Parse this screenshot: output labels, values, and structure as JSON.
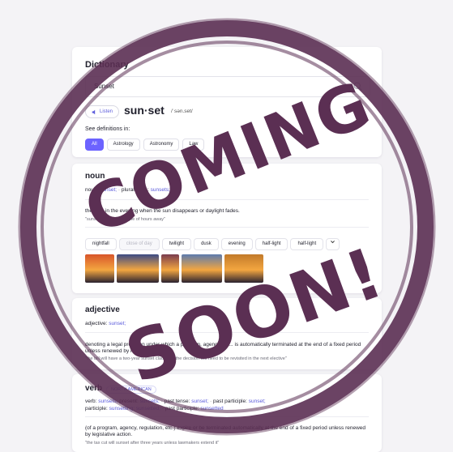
{
  "dictionary": {
    "title": "Dictionary",
    "search_value": "Sunset",
    "listen_label": "Listen",
    "word": "sun·set",
    "pronunciation": "/ˈsən.set/",
    "see_definitions_label": "See definitions in:",
    "chips": [
      "All",
      "Astrology",
      "Astronomy",
      "Law"
    ]
  },
  "noun": {
    "pos": "noun",
    "forms_label": "noun:",
    "forms_value": "sunset;",
    "plural_label": "plural noun:",
    "plural_value": "sunsets;",
    "definition": "the time in the evening when the sun disappears or daylight fades.",
    "example": "\"sunset was still a couple of hours away\"",
    "synonyms": [
      "nightfall",
      "close of day",
      "twilight",
      "dusk",
      "evening",
      "half-light",
      "half-light"
    ],
    "photo_colors": [
      "#d8552a",
      "#3c4b84",
      "#7a3c4e",
      "#5c7bae",
      "#c27a2a"
    ]
  },
  "adjective": {
    "pos": "adjective",
    "forms_label": "adjective:",
    "forms_value": "sunset;",
    "definition": "denoting a legal provision under which a program, agency, or ... is automatically terminated at the end of a fixed period unless renewed by legislative action.",
    "example": "\"the bill will have a two-year sunset clause so the decision will need to be revisited in the next elective\""
  },
  "verb": {
    "pos": "verb",
    "badge": "NORTH AMERICAN",
    "forms_line1_a": "verb:",
    "forms_line1_b": "sunsets;",
    "forms_line1_c": "present:",
    "forms_line1_d": "sunsets;",
    "forms_line1_e": "past tense:",
    "forms_line1_f": "sunset;",
    "forms_line1_g": "past participle:",
    "forms_line1_h": "sunset;",
    "forms_line2_a": "participle:",
    "forms_line2_b": "sunsetting;",
    "forms_line2_c": "sunsetted;",
    "forms_line2_d": "past participle:",
    "forms_line2_e": "sunsetted",
    "definition": "(of a program, agency, regulation, etc.) expire or be terminated automatically at the end of a fixed period unless renewed by legislative action.",
    "example": "\"the tax cut will sunset after three years unless lawmakers extend it\""
  },
  "stamp": {
    "line1": "COMING",
    "line2": "SOON!",
    "color": "#5b2f53"
  }
}
